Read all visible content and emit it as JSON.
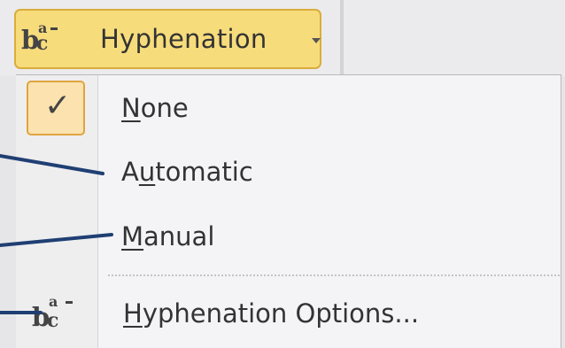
{
  "toolbar": {
    "hyphenation_label": "Hyphenation",
    "hyphenation_icon": "hyphenation-bc-icon",
    "dropdown_icon": "chevron-down-icon"
  },
  "menu": {
    "items": [
      {
        "pre": "",
        "accel": "N",
        "post": "one",
        "checked": true
      },
      {
        "pre": "A",
        "accel": "u",
        "post": "tomatic",
        "checked": false
      },
      {
        "pre": "",
        "accel": "M",
        "post": "anual",
        "checked": false
      },
      {
        "pre": "",
        "accel": "H",
        "post": "yphenation Options...",
        "checked": false
      }
    ],
    "check_glyph": "✓",
    "options_icon": "hyphenation-bc-icon"
  },
  "icon_glyph": {
    "b": "b",
    "c": "c",
    "a": "a"
  },
  "colors": {
    "button_bg": "#f7dc7c",
    "button_border": "#d9ad3c",
    "check_bg": "#fbe2ae",
    "check_border": "#e0a43f",
    "pointer_line": "#1f3f73"
  }
}
